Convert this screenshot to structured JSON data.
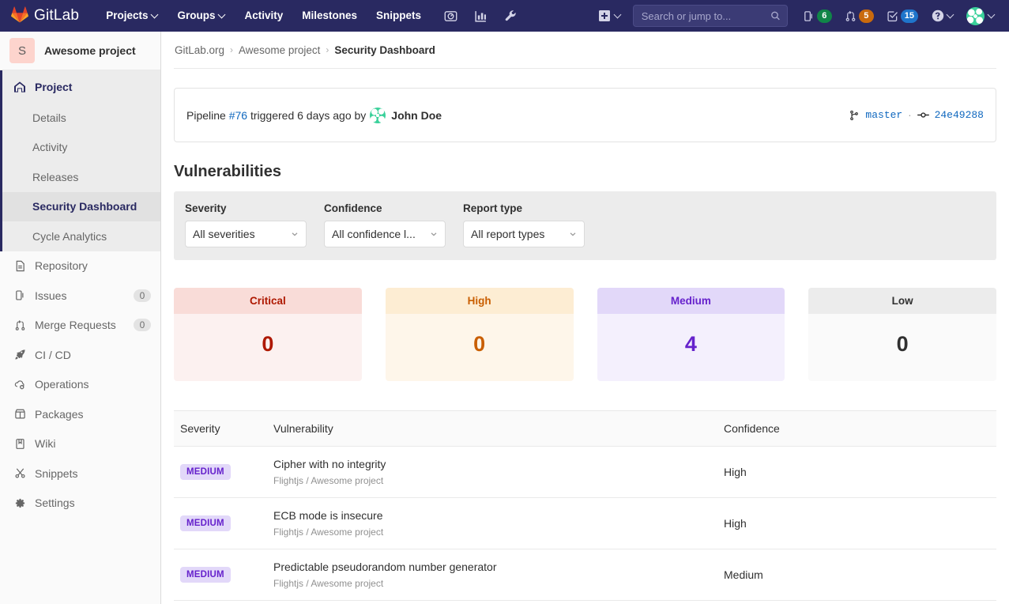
{
  "navbar": {
    "brand": "GitLab",
    "logo_icon": "gitlab-fox-logo-icon",
    "links": [
      {
        "label": "Projects",
        "has_caret": true
      },
      {
        "label": "Groups",
        "has_caret": true
      },
      {
        "label": "Activity",
        "has_caret": false
      },
      {
        "label": "Milestones",
        "has_caret": false
      },
      {
        "label": "Snippets",
        "has_caret": false
      }
    ],
    "icon_buttons": [
      {
        "name": "issue-boards-icon",
        "title": "Issue Boards"
      },
      {
        "name": "analytics-chart-icon",
        "title": "Analytics"
      },
      {
        "name": "wrench-admin-icon",
        "title": "Admin Area"
      }
    ],
    "create_new": {
      "label": "Create new",
      "icon": "plus-square-icon"
    },
    "search": {
      "placeholder": "Search or jump to...",
      "value": "",
      "icon": "search-icon"
    },
    "counters": [
      {
        "name": "issues-counter",
        "icon": "issues-icon",
        "count": "6",
        "color": "#108548"
      },
      {
        "name": "merge-requests-counter",
        "icon": "merge-request-icon",
        "count": "5",
        "color": "#c96a0d"
      },
      {
        "name": "todos-counter",
        "icon": "todo-check-icon",
        "count": "15",
        "color": "#1f75cb"
      }
    ],
    "help": {
      "icon": "question-circle-icon",
      "label": "Help"
    },
    "user": {
      "icon": "user-avatar",
      "label": "User menu"
    }
  },
  "sidebar": {
    "project": {
      "initial": "S",
      "name": "Awesome project"
    },
    "project_section": {
      "label": "Project",
      "icon": "home-icon"
    },
    "project_subitems": [
      {
        "label": "Details",
        "active": false
      },
      {
        "label": "Activity",
        "active": false
      },
      {
        "label": "Releases",
        "active": false
      },
      {
        "label": "Security Dashboard",
        "active": true
      },
      {
        "label": "Cycle Analytics",
        "active": false
      }
    ],
    "items": [
      {
        "label": "Repository",
        "icon": "document-icon",
        "count": null
      },
      {
        "label": "Issues",
        "icon": "issues-icon",
        "count": "0"
      },
      {
        "label": "Merge Requests",
        "icon": "merge-request-icon",
        "count": "0"
      },
      {
        "label": "CI / CD",
        "icon": "rocket-icon",
        "count": null
      },
      {
        "label": "Operations",
        "icon": "cloud-gear-icon",
        "count": null
      },
      {
        "label": "Packages",
        "icon": "package-icon",
        "count": null
      },
      {
        "label": "Wiki",
        "icon": "book-icon",
        "count": null
      },
      {
        "label": "Snippets",
        "icon": "scissors-icon",
        "count": null
      },
      {
        "label": "Settings",
        "icon": "gear-icon",
        "count": null
      }
    ]
  },
  "breadcrumb": {
    "items": [
      {
        "label": "GitLab.org",
        "current": false
      },
      {
        "label": "Awesome project",
        "current": false
      },
      {
        "label": "Security Dashboard",
        "current": true
      }
    ],
    "separator": "›"
  },
  "pipeline": {
    "prefix": "Pipeline",
    "number": "#76",
    "middle": "triggered 6 days ago by",
    "user": "John Doe",
    "branch_icon": "branch-icon",
    "branch": "master",
    "separator": "·",
    "commit_icon": "commit-icon",
    "commit": "24e49288"
  },
  "main": {
    "title": "Vulnerabilities"
  },
  "filters": [
    {
      "label": "Severity",
      "value": "All severities",
      "name": "severity-filter"
    },
    {
      "label": "Confidence",
      "value": "All confidence l...",
      "name": "confidence-filter"
    },
    {
      "label": "Report type",
      "value": "All report types",
      "name": "report-type-filter"
    }
  ],
  "severity_cards": [
    {
      "label": "Critical",
      "count": "0",
      "key": "critical",
      "accent": "#ae1800"
    },
    {
      "label": "High",
      "count": "0",
      "key": "high",
      "accent": "#c95e00"
    },
    {
      "label": "Medium",
      "count": "4",
      "key": "medium",
      "accent": "#6622cc"
    },
    {
      "label": "Low",
      "count": "0",
      "key": "low",
      "accent": "#303030"
    }
  ],
  "table": {
    "columns": [
      "Severity",
      "Vulnerability",
      "Confidence"
    ],
    "rows": [
      {
        "severity": "MEDIUM",
        "severity_key": "medium",
        "name": "Cipher with no integrity",
        "project": "Flightjs / Awesome project",
        "confidence": "High"
      },
      {
        "severity": "MEDIUM",
        "severity_key": "medium",
        "name": "ECB mode is insecure",
        "project": "Flightjs / Awesome project",
        "confidence": "High"
      },
      {
        "severity": "MEDIUM",
        "severity_key": "medium",
        "name": "Predictable pseudorandom number generator",
        "project": "Flightjs / Awesome project",
        "confidence": "Medium"
      }
    ]
  }
}
